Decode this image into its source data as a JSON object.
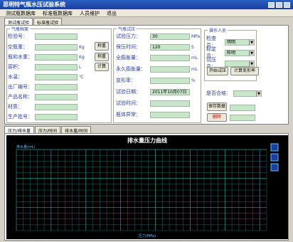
{
  "window": {
    "title": "思明特气瓶水压试验系统"
  },
  "menu": [
    "测试瓶数据库",
    "标准瓶数据库",
    "人员维护",
    "退出"
  ],
  "tabs": [
    "测试瓶试验",
    "标准瓶试验"
  ],
  "bottle_group": {
    "title": "气瓶档案",
    "fields": [
      {
        "label": "检验号：",
        "value": "",
        "unit": ""
      },
      {
        "label": "空瓶重：",
        "value": "",
        "unit": "Kg"
      },
      {
        "label": "瓶和水重：",
        "value": "",
        "unit": "Kg"
      },
      {
        "label": "容积：",
        "value": "",
        "unit": "L"
      },
      {
        "label": "水温：",
        "value": "",
        "unit": "℃"
      },
      {
        "label": "出厂编号：",
        "value": "",
        "unit": ""
      },
      {
        "label": "产品名称：",
        "value": "",
        "unit": ""
      },
      {
        "label": "材质：",
        "value": "",
        "unit": ""
      },
      {
        "label": "生产批号：",
        "value": "",
        "unit": ""
      }
    ],
    "buttons": {
      "weigh1": "称重",
      "weigh2": "称重",
      "calc": "计算"
    }
  },
  "test_group": {
    "title": "气瓶试压",
    "fields": [
      {
        "label": "试验压力：",
        "value": "30",
        "unit": "MPa"
      },
      {
        "label": "保压时间：",
        "value": "120",
        "unit": "S"
      },
      {
        "label": "全膨胀量：",
        "value": "",
        "unit": "mL"
      },
      {
        "label": "永久膨胀量：",
        "value": "",
        "unit": "mL"
      },
      {
        "label": "变形率：",
        "value": "",
        "unit": "%"
      },
      {
        "label": "试验日期：",
        "value": "2011年10月07日",
        "unit": ""
      },
      {
        "label": "试验时间：",
        "value": "",
        "unit": ""
      },
      {
        "label": "瓶体异常：",
        "value": "",
        "unit": ""
      }
    ]
  },
  "operator_group": {
    "title": "操作人员",
    "fields": [
      {
        "label": "检查员：",
        "value": "明明"
      },
      {
        "label": "标定员：",
        "value": "陈明"
      },
      {
        "label": "试压员：",
        "value": ""
      }
    ],
    "start_button": "开始试压",
    "calc_button": "计算变形率",
    "qualified_label": "是否合格：",
    "qualified_value": "",
    "save_button": "保存数据",
    "delete_button": "删除"
  },
  "chart_tabs": [
    "压力/排水量",
    "压力/时间",
    "排水量/时间"
  ],
  "chart_data": {
    "type": "line",
    "title": "排水量压力曲线",
    "ylabel": "排水量(mL)",
    "xlabel": "压力(MPa)",
    "series": [],
    "grid": true,
    "colors": {
      "background": "#000000",
      "grid": "#2a9a9a",
      "text": "#ffffff"
    }
  }
}
